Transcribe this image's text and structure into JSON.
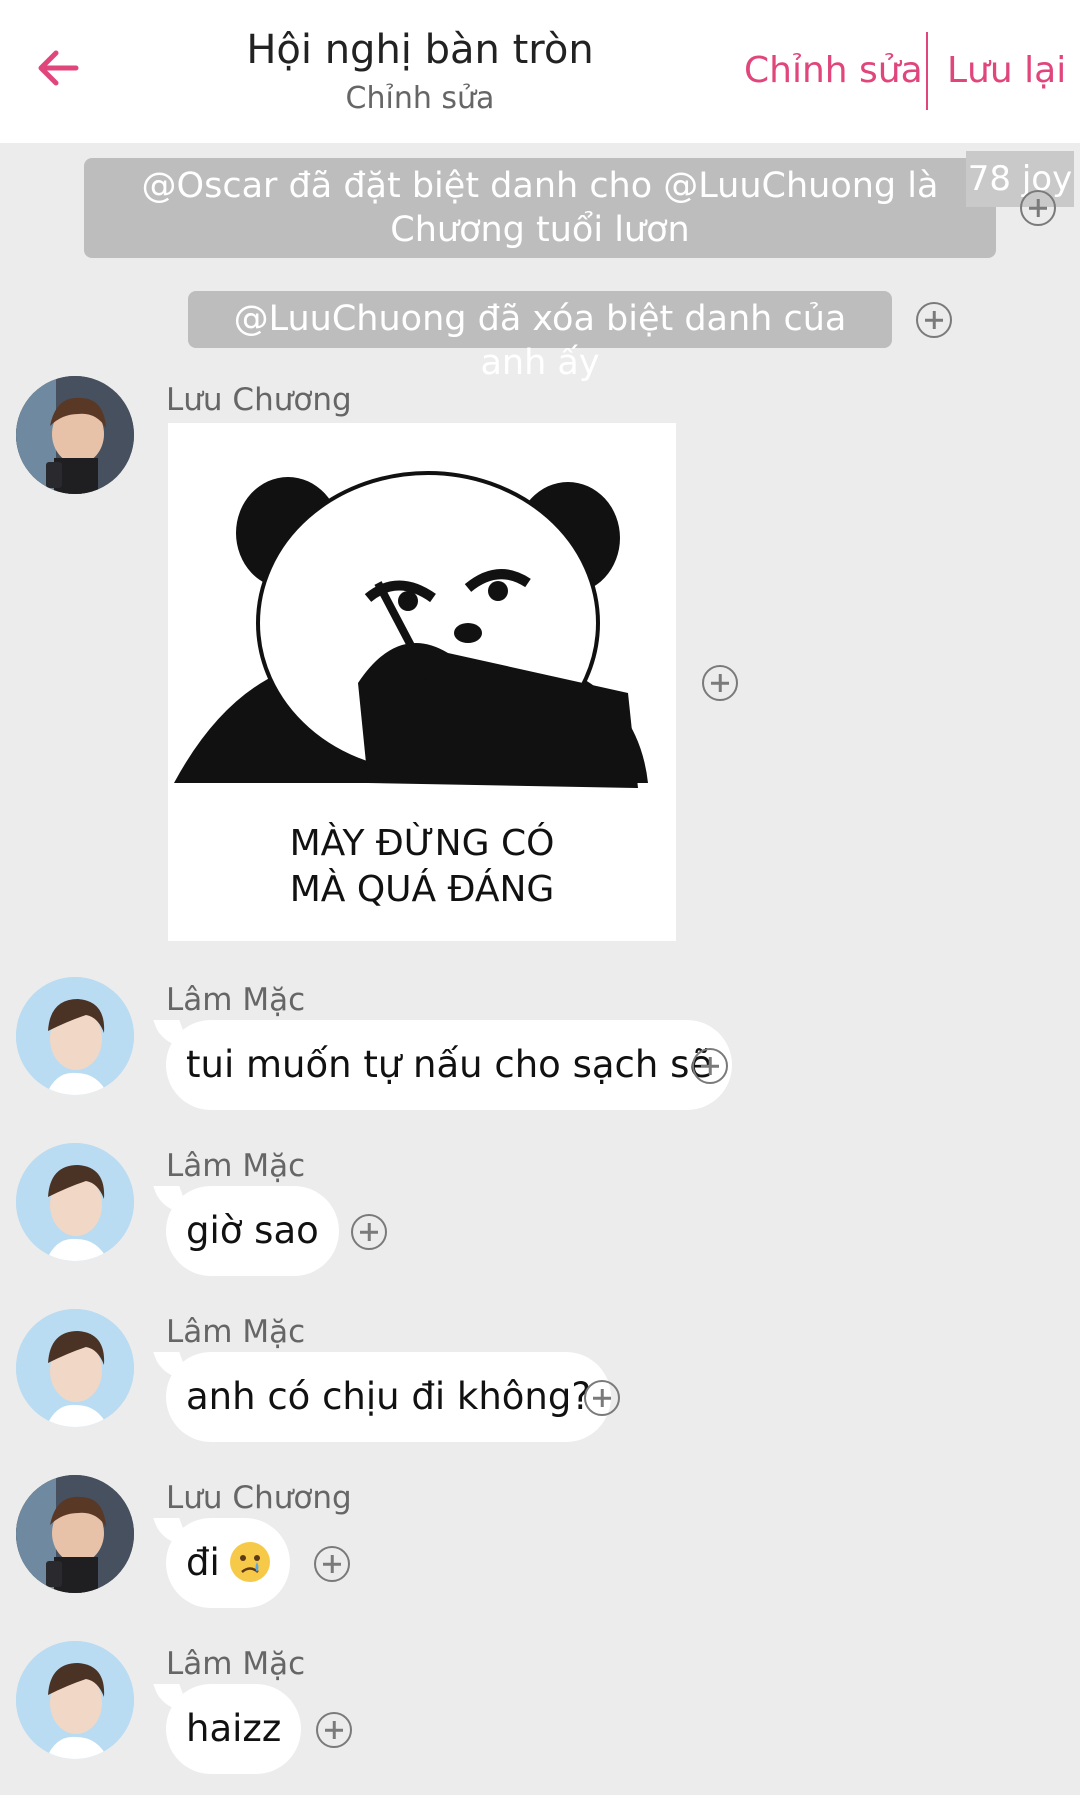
{
  "header": {
    "title": "Hội nghị bàn tròn",
    "subtitle": "Chỉnh sửa",
    "edit_label": "Chỉnh sửa",
    "save_label": "Lưu lại",
    "accent_color": "#e0457b"
  },
  "notices": [
    {
      "text": "@Oscar đã đặt biệt danh cho @LuuChuong là Chương tuổi lươn"
    },
    {
      "text": "@LuuChuong đã xóa biệt danh của anh ấy"
    }
  ],
  "badge": {
    "text": "78 joy"
  },
  "sticker": {
    "caption_line1": "MÀY ĐỪNG CÓ",
    "caption_line2": "MÀ QUÁ ĐÁNG"
  },
  "messages": [
    {
      "sender": "Lưu Chương",
      "type": "sticker"
    },
    {
      "sender": "Lâm Mặc",
      "text": "tui muốn tự nấu cho sạch sẽ"
    },
    {
      "sender": "Lâm Mặc",
      "text": "giờ sao"
    },
    {
      "sender": "Lâm Mặc",
      "text": "anh có chịu đi không?"
    },
    {
      "sender": "Lưu Chương",
      "text": "đi",
      "emoji": "crying-face"
    },
    {
      "sender": "Lâm Mặc",
      "text": "haizz"
    }
  ]
}
